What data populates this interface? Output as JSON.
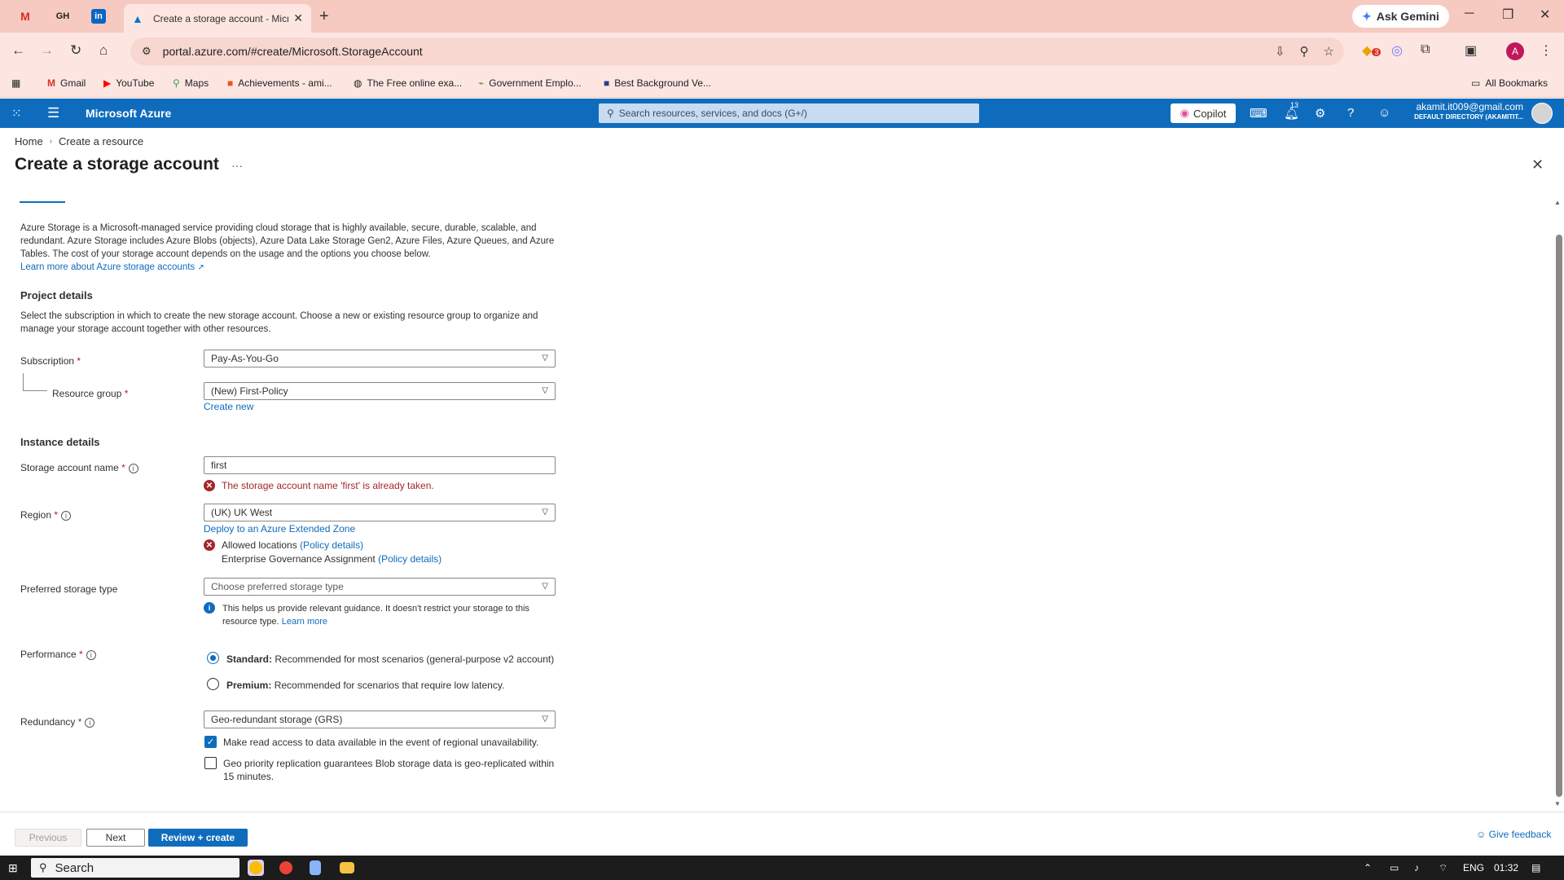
{
  "browser": {
    "pinned_tabs": [
      "M",
      "GH",
      "in"
    ],
    "tab_title": "Create a storage account - Microsoft Azure",
    "ask_gemini": "Ask Gemini",
    "url": "portal.azure.com/#create/Microsoft.StorageAccount",
    "profile_initial": "A",
    "extension_badge": "3",
    "bookmarks": [
      "Gmail",
      "YouTube",
      "Maps",
      "Achievements - ami...",
      "The Free online exa...",
      "Government Emplo...",
      "Best Background Ve..."
    ],
    "all_bookmarks": "All Bookmarks"
  },
  "azure": {
    "brand": "Microsoft Azure",
    "search_placeholder": "Search resources, services, and docs (G+/)",
    "copilot": "Copilot",
    "notif_count": "13",
    "user_email": "akamit.it009@gmail.com",
    "user_directory": "DEFAULT DIRECTORY (AKAMITIT..."
  },
  "page": {
    "breadcrumb": [
      "Home",
      "Create a resource"
    ],
    "title": "Create a storage account",
    "ellipsis": "···",
    "description": "Azure Storage is a Microsoft-managed service providing cloud storage that is highly available, secure, durable, scalable, and redundant. Azure Storage includes Azure Blobs (objects), Azure Data Lake Storage Gen2, Azure Files, Azure Queues, and Azure Tables. The cost of your storage account depends on the usage and the options you choose below.",
    "learn_more_link": "Learn more about Azure storage accounts",
    "project_details": {
      "heading": "Project details",
      "text": "Select the subscription in which to create the new storage account. Choose a new or existing resource group to organize and manage your storage account together with other resources.",
      "subscription_label": "Subscription",
      "subscription_value": "Pay-As-You-Go",
      "resource_group_label": "Resource group",
      "resource_group_value": "(New) First-Policy",
      "create_new": "Create new"
    },
    "instance_details": {
      "heading": "Instance details",
      "name_label": "Storage account name",
      "name_value": "first",
      "name_error": "The storage account name 'first' is already taken.",
      "region_label": "Region",
      "region_value": "(UK) UK West",
      "extended_zone_link": "Deploy to an Azure Extended Zone",
      "allowed_locations": "Allowed locations",
      "policy_details": "(Policy details)",
      "governance": "Enterprise Governance Assignment",
      "storage_type_label": "Preferred storage type",
      "storage_type_placeholder": "Choose preferred storage type",
      "storage_type_info": "This helps us provide relevant guidance. It doesn't restrict your storage to this resource type.",
      "learn_more": "Learn more",
      "performance_label": "Performance",
      "standard_bold": "Standard:",
      "standard_text": "Recommended for most scenarios (general-purpose v2 account)",
      "premium_bold": "Premium:",
      "premium_text": "Recommended for scenarios that require low latency.",
      "redundancy_label": "Redundancy",
      "redundancy_value": "Geo-redundant storage (GRS)",
      "read_access": "Make read access to data available in the event of regional unavailability.",
      "geo_priority": "Geo priority replication guarantees Blob storage data is geo-replicated within 15 minutes."
    },
    "required_mark": "*"
  },
  "footer": {
    "previous": "Previous",
    "next": "Next",
    "review_create": "Review + create",
    "feedback": "Give feedback"
  },
  "taskbar": {
    "search": "Search",
    "lang": "ENG",
    "time": "01:32"
  }
}
